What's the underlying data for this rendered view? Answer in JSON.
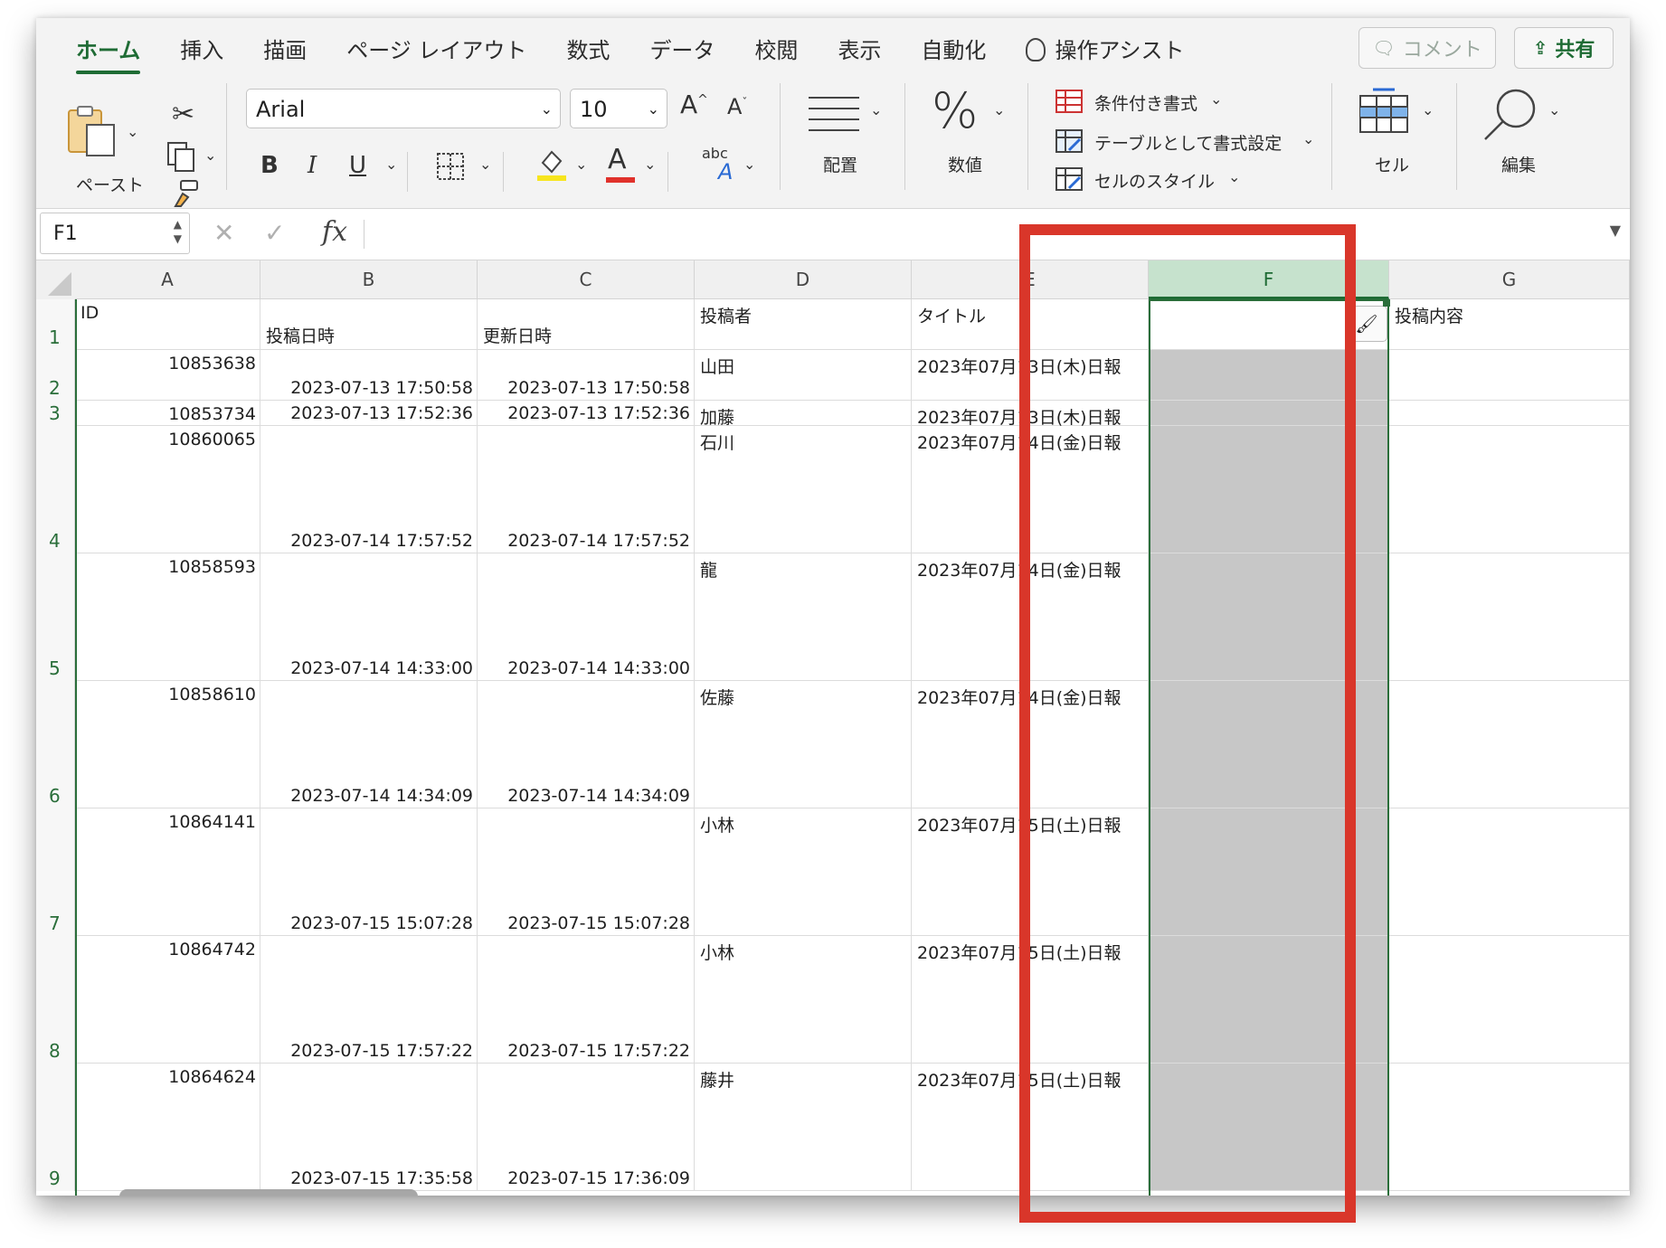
{
  "ribbon": {
    "tabs": [
      "ホーム",
      "挿入",
      "描画",
      "ページ レイアウト",
      "数式",
      "データ",
      "校閲",
      "表示",
      "自動化",
      "操作アシスト"
    ],
    "comment_label": "コメント",
    "share_label": "共有",
    "paste_label": "ペースト",
    "font_name": "Arial",
    "font_size": "10",
    "align_label": "配置",
    "number_label": "数値",
    "cond_format_label": "条件付き書式",
    "table_format_label": "テーブルとして書式設定",
    "cell_style_label": "セルのスタイル",
    "cells_label": "セル",
    "edit_label": "編集",
    "bold": "B",
    "italic": "I",
    "underline": "U",
    "font_color_glyph": "A",
    "grow_font": "A",
    "shrink_font": "A",
    "abc_label": "abc",
    "highlight_color": "#f7e51e",
    "font_color": "#e0312b"
  },
  "formula_bar": {
    "name_box": "F1",
    "formula": ""
  },
  "columns": [
    {
      "label": "A"
    },
    {
      "label": "B"
    },
    {
      "label": "C"
    },
    {
      "label": "D"
    },
    {
      "label": "E"
    },
    {
      "label": "F",
      "selected": true
    },
    {
      "label": "G"
    }
  ],
  "header_row": {
    "row": "1",
    "A": "ID",
    "B": "投稿日時",
    "C": "更新日時",
    "D": "投稿者",
    "E": "タイトル",
    "F": "",
    "G": "投稿内容"
  },
  "rows": [
    {
      "row": "2",
      "A": "10853638",
      "B": "2023-07-13 17:50:58",
      "C": "2023-07-13 17:50:58",
      "D": "山田",
      "E": "2023年07月13日(木)日報"
    },
    {
      "row": "3",
      "A": "10853734",
      "B": "2023-07-13 17:52:36",
      "C": "2023-07-13 17:52:36",
      "D": "加藤",
      "E": "2023年07月13日(木)日報"
    },
    {
      "row": "4",
      "A": "10860065",
      "B": "2023-07-14 17:57:52",
      "C": "2023-07-14 17:57:52",
      "D": "石川",
      "E": "2023年07月14日(金)日報"
    },
    {
      "row": "5",
      "A": "10858593",
      "B": "2023-07-14 14:33:00",
      "C": "2023-07-14 14:33:00",
      "D": "龍",
      "E": "2023年07月14日(金)日報"
    },
    {
      "row": "6",
      "A": "10858610",
      "B": "2023-07-14 14:34:09",
      "C": "2023-07-14 14:34:09",
      "D": "佐藤",
      "E": "2023年07月14日(金)日報"
    },
    {
      "row": "7",
      "A": "10864141",
      "B": "2023-07-15 15:07:28",
      "C": "2023-07-15 15:07:28",
      "D": "小林",
      "E": "2023年07月15日(土)日報"
    },
    {
      "row": "8",
      "A": "10864742",
      "B": "2023-07-15 17:57:22",
      "C": "2023-07-15 17:57:22",
      "D": "小林",
      "E": "2023年07月15日(土)日報"
    },
    {
      "row": "9",
      "A": "10864624",
      "B": "2023-07-15 17:35:58",
      "C": "2023-07-15 17:36:09",
      "D": "藤井",
      "E": "2023年07月15日(土)日報"
    }
  ],
  "colors": {
    "accent": "#1e6b34",
    "highlight_box": "#d9362a",
    "selected_fill": "#c7c7c7"
  }
}
